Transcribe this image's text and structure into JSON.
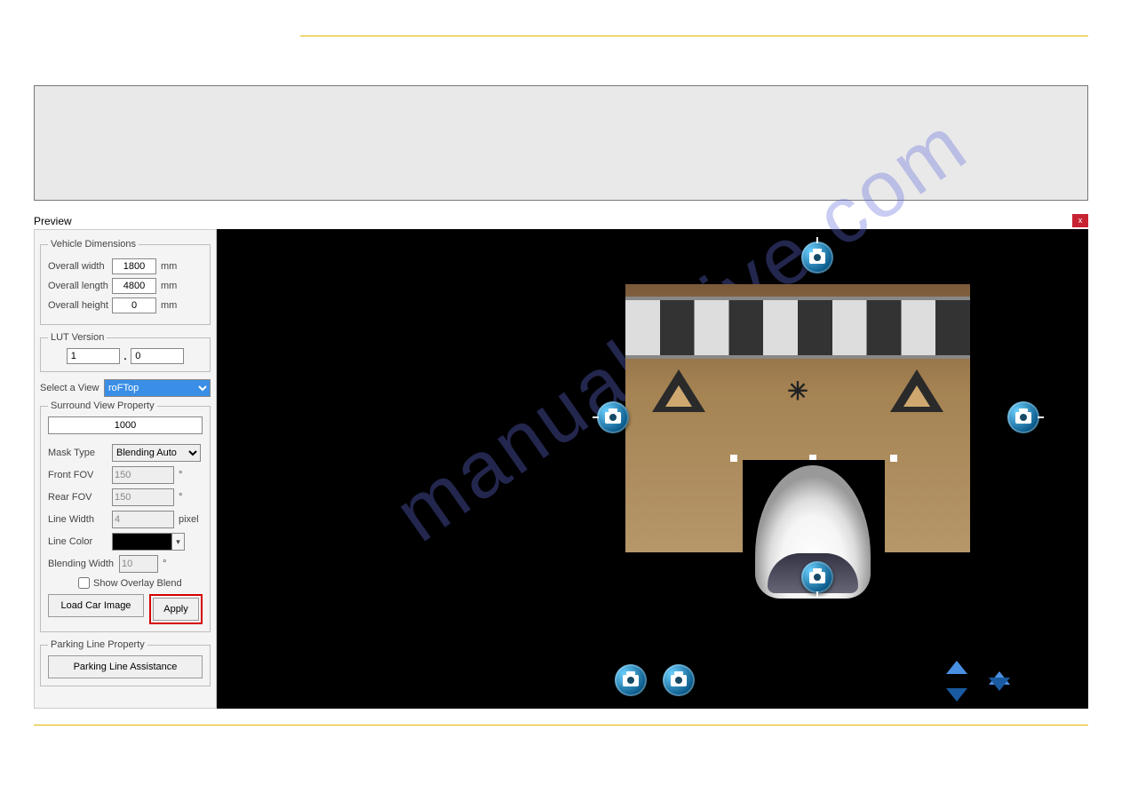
{
  "window": {
    "title": "Preview",
    "close": "x"
  },
  "vehicle_dimensions": {
    "legend": "Vehicle Dimensions",
    "overall_width_label": "Overall width",
    "overall_width": "1800",
    "overall_length_label": "Overall length",
    "overall_length": "4800",
    "overall_height_label": "Overall height",
    "overall_height": "0",
    "unit": "mm"
  },
  "lut_version": {
    "legend": "LUT Version",
    "major": "1",
    "dot": ".",
    "minor": "0"
  },
  "select_view": {
    "label": "Select a View",
    "value": "roFTop"
  },
  "surround_view": {
    "legend": "Surround View Property",
    "top_value": "1000",
    "mask_type_label": "Mask Type",
    "mask_type": "Blending Auto",
    "front_fov_label": "Front FOV",
    "front_fov": "150",
    "rear_fov_label": "Rear FOV",
    "rear_fov": "150",
    "line_width_label": "Line Width",
    "line_width": "4",
    "line_width_unit": "pixel",
    "line_color_label": "Line Color",
    "line_color": "#000000",
    "blending_width_label": "Blending Width",
    "blending_width": "10",
    "deg_unit": "°",
    "show_overlay_blend_label": "Show Overlay Blend",
    "load_car_image": "Load Car Image",
    "apply": "Apply"
  },
  "parking_line": {
    "legend": "Parking Line Property",
    "button": "Parking Line Assistance"
  },
  "watermark": "manualshive.com"
}
